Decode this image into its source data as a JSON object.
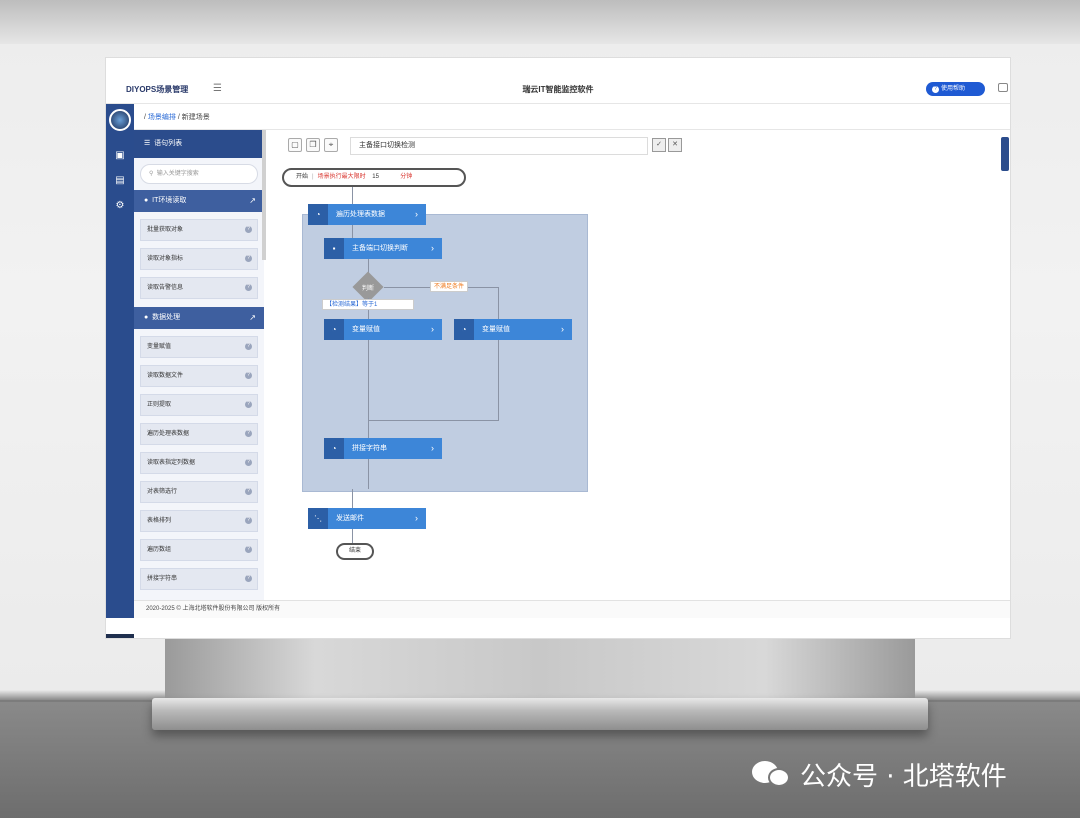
{
  "app": {
    "brand": "DIYOPS场景管理",
    "title": "瑞云IT智能监控软件",
    "help_button": "使用帮助"
  },
  "breadcrumb": {
    "items": [
      "场景编排",
      "新建场景"
    ]
  },
  "panel": {
    "title": "语句列表",
    "search_placeholder": "输入关键字搜索",
    "groups": [
      {
        "label": "IT环境读取",
        "items": [
          "批量获取对象",
          "读取对象指标",
          "读取告警信息"
        ]
      },
      {
        "label": "数据处理",
        "items": [
          "变量赋值",
          "读取数据文件",
          "正则提取",
          "遍历处理表数据",
          "读取表指定列数据",
          "对表筛选行",
          "表格排列",
          "遍历数组",
          "拼接字符串"
        ]
      }
    ]
  },
  "toolbar": {
    "scene_name": "主备接口切换检测"
  },
  "flow": {
    "start_label": "开始",
    "max_time_label": "场景执行最大限时",
    "max_time_value": "15",
    "max_time_unit": "分钟",
    "loop_node": "遍历处理表数据",
    "node_switch": "主备端口切换判断",
    "decision": "判断",
    "cond_false": "不满足条件",
    "cond_true": "【检测结果】等于1",
    "assign_left": "变量赋值",
    "assign_right": "变量赋值",
    "concat": "拼接字符串",
    "send_mail": "发送邮件",
    "end_label": "结束"
  },
  "footer": {
    "text": "2020-2025 © 上海北塔软件股份有限公司 版权所有"
  },
  "watermark": {
    "text": "公众号 · 北塔软件"
  },
  "colors": {
    "nav": "#2b4c8c",
    "node": "#3d86d8",
    "loop_region": "#c0cde1",
    "help_button": "#1f5ad3",
    "warning": "#ef7a1e"
  }
}
